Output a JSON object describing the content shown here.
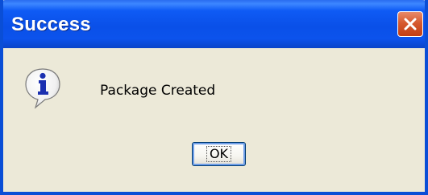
{
  "dialog": {
    "title": "Success",
    "message": "Package Created",
    "ok_label": "OK",
    "icon": "info-icon"
  },
  "colors": {
    "titlebar": "#0a50e8",
    "close_button": "#d65a30",
    "background": "#ece9d8"
  }
}
